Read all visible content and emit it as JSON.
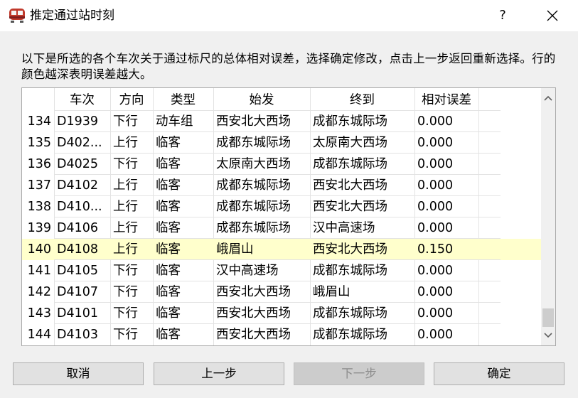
{
  "window": {
    "title": "推定通过站时刻",
    "help_label": "?"
  },
  "description": "以下是所选的各个车次关于通过标尺的总体相对误差，选择确定修改，点击上一步返回重新选择。行的颜色越深表明误差越大。",
  "table": {
    "columns": [
      "车次",
      "方向",
      "类型",
      "始发",
      "终到",
      "相对误差"
    ],
    "rows": [
      {
        "num": "134",
        "train": "D1939",
        "dir": "下行",
        "type": "动车组",
        "from": "西安北大西场",
        "to": "成都东城际场",
        "err": "0.000"
      },
      {
        "num": "135",
        "train": "D402...",
        "dir": "上行",
        "type": "临客",
        "from": "成都东城际场",
        "to": "太原南大西场",
        "err": "0.000"
      },
      {
        "num": "136",
        "train": "D4025",
        "dir": "下行",
        "type": "临客",
        "from": "太原南大西场",
        "to": "成都东城际场",
        "err": "0.000"
      },
      {
        "num": "137",
        "train": "D4102",
        "dir": "上行",
        "type": "临客",
        "from": "成都东城际场",
        "to": "西安北大西场",
        "err": "0.000"
      },
      {
        "num": "138",
        "train": "D410...",
        "dir": "上行",
        "type": "临客",
        "from": "成都东城际场",
        "to": "西安北大西场",
        "err": "0.000"
      },
      {
        "num": "139",
        "train": "D4106",
        "dir": "上行",
        "type": "临客",
        "from": "成都东城际场",
        "to": "汉中高速场",
        "err": "0.000"
      },
      {
        "num": "140",
        "train": "D4108",
        "dir": "上行",
        "type": "临客",
        "from": "峨眉山",
        "to": "西安北大西场",
        "err": "0.150"
      },
      {
        "num": "141",
        "train": "D4105",
        "dir": "下行",
        "type": "临客",
        "from": "汉中高速场",
        "to": "成都东城际场",
        "err": "0.000"
      },
      {
        "num": "142",
        "train": "D4107",
        "dir": "下行",
        "type": "临客",
        "from": "西安北大西场",
        "to": "峨眉山",
        "err": "0.000"
      },
      {
        "num": "143",
        "train": "D4101",
        "dir": "下行",
        "type": "临客",
        "from": "西安北大西场",
        "to": "成都东城际场",
        "err": "0.000"
      },
      {
        "num": "144",
        "train": "D4103",
        "dir": "下行",
        "type": "临客",
        "from": "西安北大西场",
        "to": "成都东城际场",
        "err": "0.000"
      }
    ],
    "highlight_color": "#ffffcc"
  },
  "buttons": {
    "cancel": "取消",
    "prev": "上一步",
    "next": "下一步",
    "ok": "确定"
  },
  "icons": {
    "app": "train-icon",
    "close": "close-icon",
    "scroll_up": "chevron-up-icon",
    "scroll_down": "chevron-down-icon"
  }
}
